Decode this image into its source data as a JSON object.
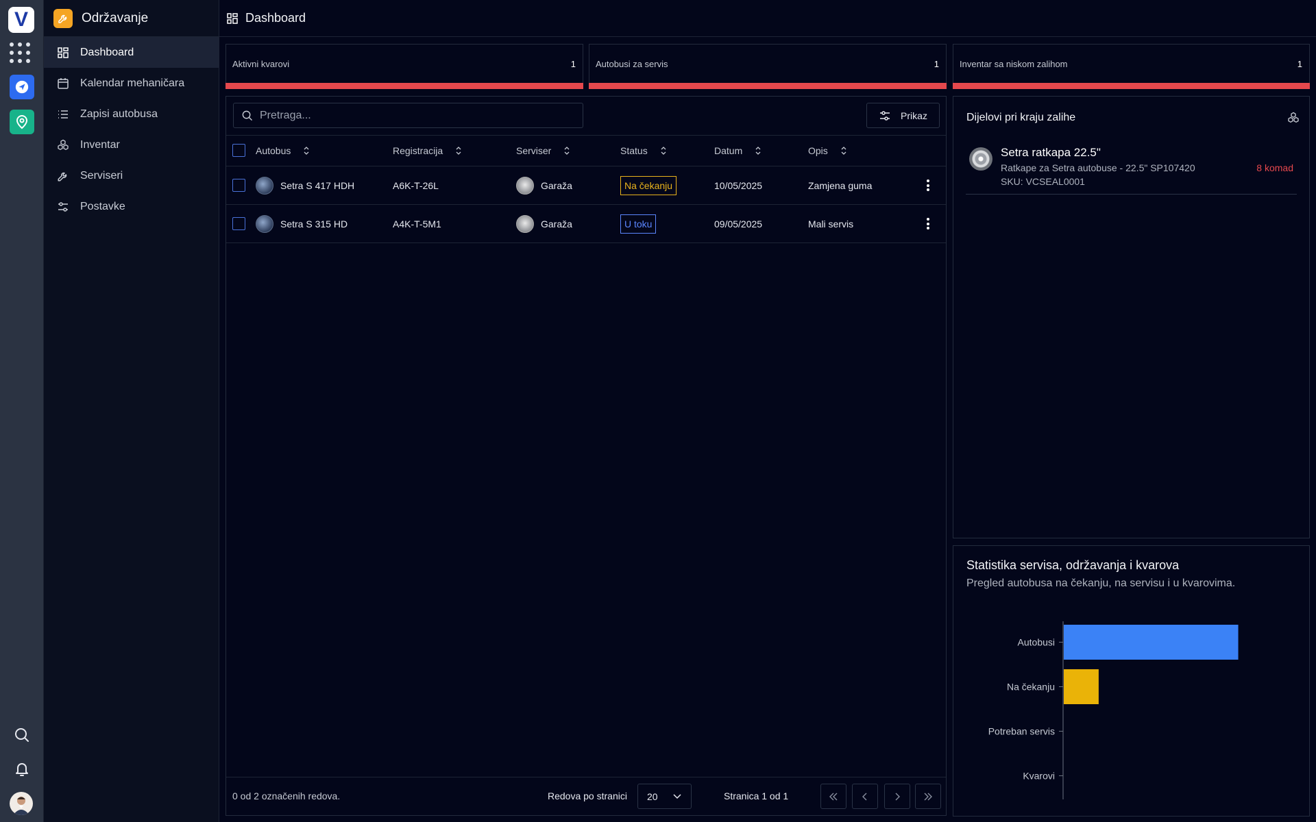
{
  "rail": {
    "logo_letter": "V"
  },
  "sidebar": {
    "app_name": "Održavanje",
    "items": [
      {
        "label": "Dashboard",
        "icon": "dashboard-icon",
        "active": true
      },
      {
        "label": "Kalendar mehaničara",
        "icon": "calendar-icon",
        "active": false
      },
      {
        "label": "Zapisi autobusa",
        "icon": "list-icon",
        "active": false
      },
      {
        "label": "Inventar",
        "icon": "cubes-icon",
        "active": false
      },
      {
        "label": "Serviseri",
        "icon": "wrench-icon",
        "active": false
      },
      {
        "label": "Postavke",
        "icon": "sliders-icon",
        "active": false
      }
    ]
  },
  "header": {
    "title": "Dashboard"
  },
  "stats": [
    {
      "label": "Aktivni kvarovi",
      "value": "1"
    },
    {
      "label": "Autobusi za servis",
      "value": "1"
    },
    {
      "label": "Inventar sa niskom zalihom",
      "value": "1"
    }
  ],
  "colors": {
    "accent_red": "#e5484d",
    "status_pending": "#e9b31c",
    "status_progress": "#5b86ff",
    "chart_blue": "#3b82f6",
    "chart_yellow": "#eab308"
  },
  "table": {
    "search_placeholder": "Pretraga...",
    "view_button": "Prikaz",
    "columns": [
      "Autobus",
      "Registracija",
      "Serviser",
      "Status",
      "Datum",
      "Opis"
    ],
    "rows": [
      {
        "bus": "Setra S 417 HDH",
        "registration": "A6K-T-26L",
        "mechanic": "Garaža",
        "status": "Na čekanju",
        "status_type": "pending",
        "date": "10/05/2025",
        "description": "Zamjena guma"
      },
      {
        "bus": "Setra S 315 HD",
        "registration": "A4K-T-5M1",
        "mechanic": "Garaža",
        "status": "U toku",
        "status_type": "progress",
        "date": "09/05/2025",
        "description": "Mali servis"
      }
    ],
    "footer": {
      "selection": "0 od 2 označenih redova.",
      "rows_per_page_label": "Redova po stranici",
      "rows_per_page": "20",
      "page_info": "Stranica 1 od 1"
    }
  },
  "low_stock": {
    "title": "Dijelovi pri kraju zalihe",
    "items": [
      {
        "name": "Setra ratkapa 22.5\"",
        "description": "Ratkape za Setra autobuse - 22.5\" SP107420",
        "sku": "SKU: VCSEAL0001",
        "quantity": "8 komad"
      }
    ]
  },
  "stats_panel": {
    "title": "Statistika servisa, održavanja i kvarova",
    "subtitle": "Pregled autobusa na čekanju, na servisu i u kvarovima."
  },
  "chart_data": {
    "type": "bar",
    "orientation": "horizontal",
    "categories": [
      "Autobusi",
      "Na čekanju",
      "Potreban servis",
      "Kvarovi"
    ],
    "values": [
      2,
      0.4,
      0,
      0
    ],
    "colors": [
      "#3b82f6",
      "#eab308",
      "#ef4444",
      "#ef4444"
    ],
    "title": "",
    "xlabel": "",
    "ylabel": "",
    "xlim": [
      0,
      2.2
    ],
    "grid": false
  }
}
